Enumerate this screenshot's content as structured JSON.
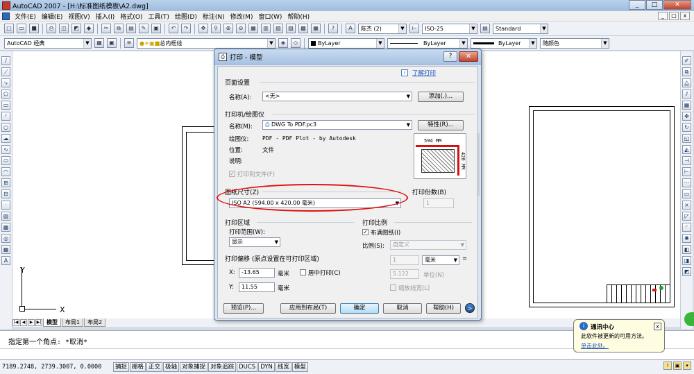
{
  "window": {
    "title": "AutoCAD 2007 - [H:\\标准图纸模板\\A2.dwg]",
    "minimize": "_",
    "restore": "□",
    "close": "✕"
  },
  "menu": [
    "文件(E)",
    "编辑(E)",
    "视图(V)",
    "插入(I)",
    "格式(O)",
    "工具(T)",
    "绘图(D)",
    "标注(N)",
    "修改(M)",
    "窗口(W)",
    "帮助(H)"
  ],
  "toolbar1": {
    "text_style": "陈杰 (2)",
    "dim_style": "ISO-25",
    "table_style": "Standard"
  },
  "toolbar2": {
    "workspace": "AutoCAD 经典",
    "layer": "总内框线",
    "color": "ByLayer",
    "linetype": "ByLayer",
    "lineweight": "ByLayer",
    "plotstyle": "随颜色"
  },
  "ucs": {
    "x_label": "X",
    "y_label": "Y"
  },
  "layout_tabs": {
    "model": "模型",
    "layout1": "布局1",
    "layout2": "布局2"
  },
  "command": {
    "line1": "指定第一个角点: *取消*"
  },
  "statusbar": {
    "coords": "7189.2748, 2739.3007, 0.0000",
    "buttons": [
      "捕捉",
      "栅格",
      "正交",
      "极轴",
      "对象捕捉",
      "对象追踪",
      "DUCS",
      "DYN",
      "线宽",
      "模型"
    ]
  },
  "dialog": {
    "title": "打印 - 模型",
    "help_btn": "?",
    "close_btn": "✕",
    "learn_link": "了解打印",
    "page_setup": {
      "group": "页面设置",
      "name_label": "名称(A):",
      "name_value": "<无>",
      "add_btn": "添加(.)..."
    },
    "plotter": {
      "group": "打印机/绘图仪",
      "name_label": "名称(M):",
      "name_value": "DWG To PDF.pc3",
      "props_btn": "特性(R)...",
      "plotter_label": "绘图仪:",
      "plotter_value": "PDF - PDF Plot - by Autodesk",
      "location_label": "位置:",
      "location_value": "文件",
      "desc_label": "说明:",
      "print_to_file": "打印到文件(F)",
      "preview_width": "594 MM",
      "preview_height": "420 MM"
    },
    "paper_size": {
      "group": "图纸尺寸(Z)",
      "value": "ISO A2 (594.00 x 420.00 毫米)"
    },
    "copies": {
      "group": "打印份数(B)",
      "value": "1"
    },
    "plot_area": {
      "group": "打印区域",
      "range_label": "打印范围(W):",
      "range_value": "显示"
    },
    "plot_scale": {
      "group": "打印比例",
      "fit_label": "布满图纸(I)",
      "scale_label": "比例(S):",
      "scale_value": "自定义",
      "num_value": "1",
      "unit_value": "毫米",
      "equals": "=",
      "den_value": "5.122",
      "unit_label": "单位(N)",
      "lineweights_label": "缩放线宽(L)"
    },
    "plot_offset": {
      "group": "打印偏移 (原点设置在可打印区域)",
      "x_label": "X:",
      "x_value": "-13.65",
      "x_unit": "毫米",
      "center_label": "居中打印(C)",
      "y_label": "Y:",
      "y_value": "11.55",
      "y_unit": "毫米"
    },
    "buttons": {
      "preview": "预览(P)...",
      "apply": "应用到布局(T)",
      "ok": "确定",
      "cancel": "取消",
      "help": "帮助(H)",
      "more": ">"
    }
  },
  "balloon": {
    "title": "通讯中心",
    "message": "此软件被更新的可用方法。",
    "link": "单击此处。",
    "close": "x"
  }
}
